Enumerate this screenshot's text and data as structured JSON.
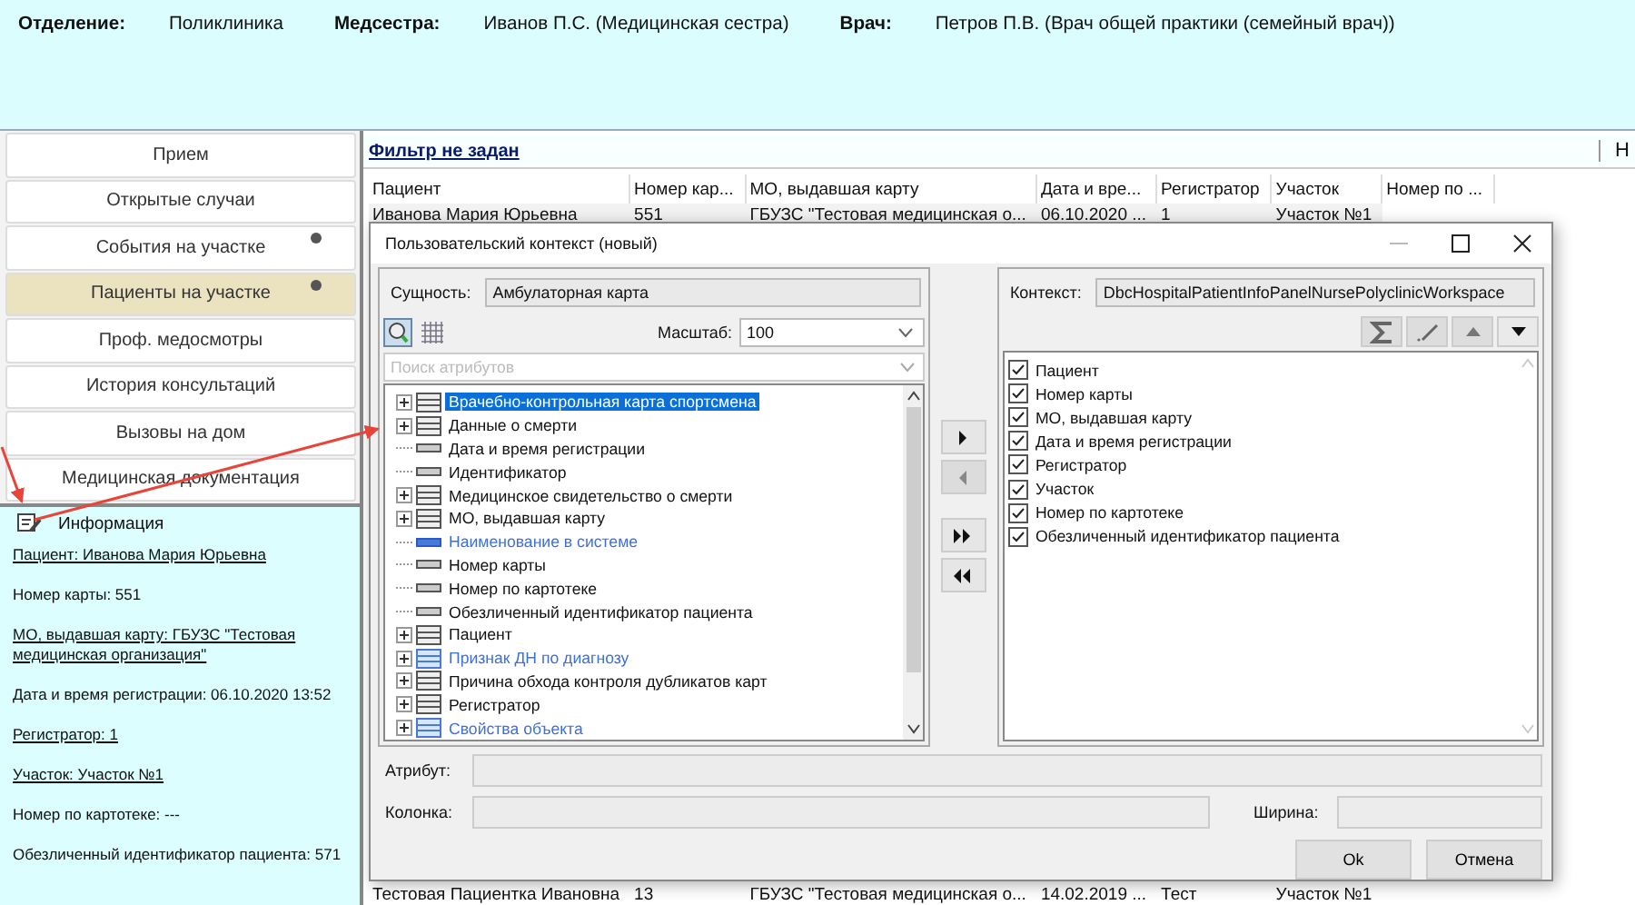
{
  "header": {
    "fields": [
      {
        "label": "Отделение:",
        "value": "Поликлиника"
      },
      {
        "label": "Медсестра:",
        "value": "Иванов П.С. (Медицинская сестра)"
      },
      {
        "label": "Врач:",
        "value": "Петров П.В. (Врач общей практики (семейный врач))"
      }
    ]
  },
  "nav": {
    "items": [
      {
        "label": "Прием",
        "selected": false,
        "dot": false
      },
      {
        "label": "Открытые случаи",
        "selected": false,
        "dot": false
      },
      {
        "label": "События на участке",
        "selected": false,
        "dot": true
      },
      {
        "label": "Пациенты на участке",
        "selected": true,
        "dot": true
      },
      {
        "label": "Проф. медосмотры",
        "selected": false,
        "dot": false
      },
      {
        "label": "История консультаций",
        "selected": false,
        "dot": false
      },
      {
        "label": "Вызовы на дом",
        "selected": false,
        "dot": false
      },
      {
        "label": "Медицинская документация",
        "selected": false,
        "dot": false
      }
    ]
  },
  "info": {
    "title": "Информация",
    "lines": [
      {
        "text": "Пациент: Иванова Мария Юрьевна",
        "link": true
      },
      {
        "text": "Номер карты: 551",
        "link": false
      },
      {
        "text": "МО, выдавшая карту: ГБУЗС \"Тестовая медицинская организация\"",
        "link": true
      },
      {
        "text": "Дата и время регистрации: 06.10.2020 13:52",
        "link": false
      },
      {
        "text": "Регистратор: 1",
        "link": true
      },
      {
        "text": "Участок: Участок №1",
        "link": true
      },
      {
        "text": "Номер по картотеке: ---",
        "link": false
      },
      {
        "text": "Обезличенный идентификатор пациента: 571",
        "link": false
      }
    ]
  },
  "filter": {
    "link": "Фильтр не задан",
    "right_button": "Н"
  },
  "table": {
    "columns": [
      "Пациент",
      "Номер кар...",
      "МО, выдавшая карту",
      "Дата и вре...",
      "Регистратор",
      "Участок",
      "Номер по ..."
    ],
    "rows": [
      [
        "Иванова Мария Юрьевна",
        "551",
        "ГБУЗС \"Тестовая медицинская о...",
        "06.10.2020 ...",
        "1",
        "Участок №1",
        ""
      ],
      [
        "Тестовая Пациентка Ивановна",
        "13",
        "ГБУЗС \"Тестовая медицинская о...",
        "14.02.2019 ...",
        "Тест",
        "Участок №1",
        ""
      ]
    ]
  },
  "dialog": {
    "title": "Пользовательский контекст (новый)",
    "entity": {
      "label": "Сущность:",
      "value": "Амбулаторная карта"
    },
    "scale": {
      "label": "Масштаб:",
      "value": "100"
    },
    "search": {
      "placeholder": "Поиск атрибутов"
    },
    "tree": [
      {
        "label": "Врачебно-контрольная карта спортсмена",
        "kind": "group",
        "system": false,
        "selected": true
      },
      {
        "label": "Данные о смерти",
        "kind": "group",
        "system": false,
        "selected": false
      },
      {
        "label": "Дата и время регистрации",
        "kind": "attribute",
        "system": false,
        "selected": false
      },
      {
        "label": "Идентификатор",
        "kind": "attribute",
        "system": false,
        "selected": false
      },
      {
        "label": "Медицинское свидетельство о смерти",
        "kind": "group",
        "system": false,
        "selected": false
      },
      {
        "label": "МО, выдавшая карту",
        "kind": "group",
        "system": false,
        "selected": false
      },
      {
        "label": "Наименование в системе",
        "kind": "attribute",
        "system": true,
        "selected": false
      },
      {
        "label": "Номер карты",
        "kind": "attribute",
        "system": false,
        "selected": false
      },
      {
        "label": "Номер по картотеке",
        "kind": "attribute",
        "system": false,
        "selected": false
      },
      {
        "label": "Обезличенный идентификатор пациента",
        "kind": "attribute",
        "system": false,
        "selected": false
      },
      {
        "label": "Пациент",
        "kind": "group",
        "system": false,
        "selected": false
      },
      {
        "label": "Признак ДН по диагнозу",
        "kind": "group",
        "system": true,
        "selected": false
      },
      {
        "label": "Причина обхода контроля дубликатов карт",
        "kind": "group",
        "system": false,
        "selected": false
      },
      {
        "label": "Регистратор",
        "kind": "group",
        "system": false,
        "selected": false
      },
      {
        "label": "Свойства объекта",
        "kind": "group",
        "system": true,
        "selected": false
      }
    ],
    "context": {
      "label": "Контекст:",
      "value": "DbcHospitalPatientInfoPanelNursePolyclinicWorkspace"
    },
    "columns": [
      {
        "label": "Пациент",
        "checked": true
      },
      {
        "label": "Номер карты",
        "checked": true
      },
      {
        "label": "МО, выдавшая карту",
        "checked": true
      },
      {
        "label": "Дата и время регистрации",
        "checked": true
      },
      {
        "label": "Регистратор",
        "checked": true
      },
      {
        "label": "Участок",
        "checked": true
      },
      {
        "label": "Номер по картотеке",
        "checked": true
      },
      {
        "label": "Обезличенный идентификатор пациента",
        "checked": true
      }
    ],
    "attribute": {
      "label": "Атрибут:"
    },
    "column": {
      "label": "Колонка:"
    },
    "width": {
      "label": "Ширина:"
    },
    "buttons": [
      "Ok",
      "Отмена"
    ]
  }
}
